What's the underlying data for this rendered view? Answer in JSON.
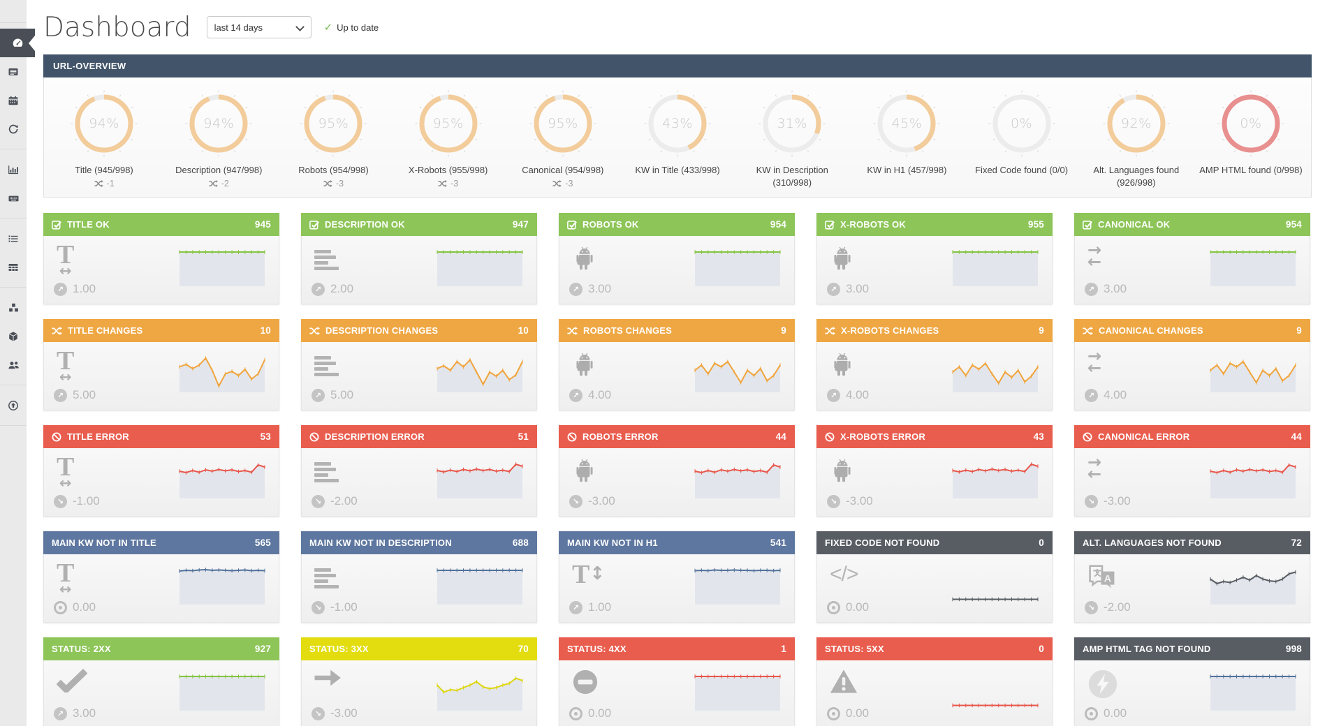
{
  "header": {
    "title": "Dashboard",
    "range_selected": "last 14 days",
    "status": "Up to date"
  },
  "sidebar": {
    "active": "dashboard",
    "groups": [
      [
        "dashboard",
        "news",
        "calendar",
        "sync"
      ],
      [
        "bar-chart",
        "keyboard"
      ],
      [
        "list",
        "table"
      ],
      [
        "cubes",
        "cube",
        "users"
      ],
      [
        "upload"
      ]
    ]
  },
  "overview": {
    "title": "URL-OVERVIEW",
    "gauges": [
      {
        "percent": 94,
        "label": "Title (945/998)",
        "delta": "-1",
        "ring": "orange"
      },
      {
        "percent": 94,
        "label": "Description (947/998)",
        "delta": "-2",
        "ring": "orange"
      },
      {
        "percent": 95,
        "label": "Robots (954/998)",
        "delta": "-3",
        "ring": "orange"
      },
      {
        "percent": 95,
        "label": "X-Robots (955/998)",
        "delta": "-3",
        "ring": "orange"
      },
      {
        "percent": 95,
        "label": "Canonical (954/998)",
        "delta": "-3",
        "ring": "orange"
      },
      {
        "percent": 43,
        "label": "KW in Title (433/998)",
        "delta": "",
        "ring": "orange"
      },
      {
        "percent": 31,
        "label": "KW in Description (310/998)",
        "delta": "",
        "ring": "orange"
      },
      {
        "percent": 45,
        "label": "KW in H1 (457/998)",
        "delta": "",
        "ring": "orange"
      },
      {
        "percent": 0,
        "label": "Fixed Code found (0/0)",
        "delta": "",
        "ring": "gray"
      },
      {
        "percent": 92,
        "label": "Alt. Languages found (926/998)",
        "delta": "",
        "ring": "orange"
      },
      {
        "percent": 0,
        "label": "AMP HTML found (0/998)",
        "delta": "",
        "ring": "red"
      }
    ]
  },
  "cards": [
    {
      "title": "TITLE OK",
      "value": "945",
      "variant": "green",
      "header_icon": "check-square",
      "body_icon": "text-width",
      "trend": "up",
      "trend_value": "1.00",
      "spark": {
        "color": "green",
        "fill": true,
        "points": [
          0.1,
          0.1,
          0.1,
          0.1,
          0.1,
          0.1,
          0.1,
          0.1,
          0.1,
          0.1,
          0.1,
          0.1,
          0.1,
          0.1
        ]
      }
    },
    {
      "title": "DESCRIPTION OK",
      "value": "947",
      "variant": "green",
      "header_icon": "check-square",
      "body_icon": "align-left",
      "trend": "up",
      "trend_value": "2.00",
      "spark": {
        "color": "green",
        "fill": true,
        "points": [
          0.1,
          0.1,
          0.1,
          0.1,
          0.1,
          0.1,
          0.1,
          0.1,
          0.1,
          0.1,
          0.1,
          0.1,
          0.1,
          0.1
        ]
      }
    },
    {
      "title": "ROBOTS OK",
      "value": "954",
      "variant": "green",
      "header_icon": "check-square",
      "body_icon": "android",
      "trend": "up",
      "trend_value": "3.00",
      "spark": {
        "color": "green",
        "fill": true,
        "points": [
          0.1,
          0.1,
          0.1,
          0.1,
          0.1,
          0.1,
          0.1,
          0.1,
          0.1,
          0.1,
          0.1,
          0.1,
          0.1,
          0.1
        ]
      }
    },
    {
      "title": "X-ROBOTS OK",
      "value": "955",
      "variant": "green",
      "header_icon": "check-square",
      "body_icon": "android",
      "trend": "up",
      "trend_value": "3.00",
      "spark": {
        "color": "green",
        "fill": true,
        "points": [
          0.1,
          0.1,
          0.1,
          0.1,
          0.1,
          0.1,
          0.1,
          0.1,
          0.1,
          0.1,
          0.1,
          0.1,
          0.1,
          0.1
        ]
      }
    },
    {
      "title": "CANONICAL OK",
      "value": "954",
      "variant": "green",
      "header_icon": "check-square",
      "body_icon": "exchange",
      "trend": "up",
      "trend_value": "3.00",
      "spark": {
        "color": "green",
        "fill": true,
        "points": [
          0.1,
          0.1,
          0.1,
          0.1,
          0.1,
          0.1,
          0.1,
          0.1,
          0.1,
          0.1,
          0.1,
          0.1,
          0.1,
          0.1
        ]
      }
    },
    {
      "title": "TITLE CHANGES",
      "value": "10",
      "variant": "orange",
      "header_icon": "shuffle",
      "body_icon": "text-width",
      "trend": "up",
      "trend_value": "5.00",
      "spark": {
        "color": "orange",
        "fill": true,
        "points": [
          0.35,
          0.28,
          0.4,
          0.3,
          0.1,
          0.45,
          0.9,
          0.55,
          0.48,
          0.6,
          0.42,
          0.7,
          0.55,
          0.15
        ]
      }
    },
    {
      "title": "DESCRIPTION CHANGES",
      "value": "10",
      "variant": "orange",
      "header_icon": "shuffle",
      "body_icon": "align-left",
      "trend": "up",
      "trend_value": "5.00",
      "spark": {
        "color": "orange",
        "fill": true,
        "points": [
          0.4,
          0.32,
          0.45,
          0.2,
          0.35,
          0.15,
          0.5,
          0.85,
          0.5,
          0.62,
          0.45,
          0.72,
          0.58,
          0.2
        ]
      }
    },
    {
      "title": "ROBOTS CHANGES",
      "value": "9",
      "variant": "orange",
      "header_icon": "shuffle",
      "body_icon": "android",
      "trend": "up",
      "trend_value": "4.00",
      "spark": {
        "color": "orange",
        "fill": true,
        "points": [
          0.45,
          0.3,
          0.55,
          0.25,
          0.35,
          0.2,
          0.5,
          0.8,
          0.45,
          0.6,
          0.4,
          0.75,
          0.6,
          0.3
        ]
      }
    },
    {
      "title": "X-ROBOTS CHANGES",
      "value": "9",
      "variant": "orange",
      "header_icon": "shuffle",
      "body_icon": "android",
      "trend": "up",
      "trend_value": "4.00",
      "spark": {
        "color": "orange",
        "fill": true,
        "points": [
          0.5,
          0.35,
          0.6,
          0.3,
          0.42,
          0.25,
          0.55,
          0.82,
          0.5,
          0.65,
          0.45,
          0.78,
          0.62,
          0.35
        ]
      }
    },
    {
      "title": "CANONICAL CHANGES",
      "value": "9",
      "variant": "orange",
      "header_icon": "shuffle",
      "body_icon": "exchange",
      "trend": "up",
      "trend_value": "4.00",
      "spark": {
        "color": "orange",
        "fill": true,
        "points": [
          0.45,
          0.3,
          0.55,
          0.25,
          0.35,
          0.2,
          0.5,
          0.8,
          0.45,
          0.6,
          0.4,
          0.75,
          0.6,
          0.3
        ]
      }
    },
    {
      "title": "TITLE ERROR",
      "value": "53",
      "variant": "red",
      "header_icon": "ban",
      "body_icon": "text-width",
      "trend": "down",
      "trend_value": "-1.00",
      "spark": {
        "color": "red",
        "fill": true,
        "points": [
          0.3,
          0.34,
          0.28,
          0.33,
          0.26,
          0.3,
          0.25,
          0.29,
          0.26,
          0.31,
          0.28,
          0.33,
          0.12,
          0.18
        ]
      }
    },
    {
      "title": "DESCRIPTION ERROR",
      "value": "51",
      "variant": "red",
      "header_icon": "ban",
      "body_icon": "align-left",
      "trend": "down",
      "trend_value": "-2.00",
      "spark": {
        "color": "red",
        "fill": true,
        "points": [
          0.28,
          0.32,
          0.27,
          0.31,
          0.25,
          0.29,
          0.24,
          0.28,
          0.25,
          0.3,
          0.27,
          0.31,
          0.1,
          0.16
        ]
      }
    },
    {
      "title": "ROBOTS ERROR",
      "value": "44",
      "variant": "red",
      "header_icon": "ban",
      "body_icon": "android",
      "trend": "down",
      "trend_value": "-3.00",
      "spark": {
        "color": "red",
        "fill": true,
        "points": [
          0.3,
          0.34,
          0.28,
          0.33,
          0.26,
          0.3,
          0.25,
          0.29,
          0.26,
          0.31,
          0.28,
          0.33,
          0.12,
          0.18
        ]
      }
    },
    {
      "title": "X-ROBOTS ERROR",
      "value": "43",
      "variant": "red",
      "header_icon": "ban",
      "body_icon": "android",
      "trend": "down",
      "trend_value": "-3.00",
      "spark": {
        "color": "red",
        "fill": true,
        "points": [
          0.28,
          0.32,
          0.27,
          0.31,
          0.25,
          0.29,
          0.24,
          0.28,
          0.25,
          0.3,
          0.27,
          0.31,
          0.1,
          0.16
        ]
      }
    },
    {
      "title": "CANONICAL ERROR",
      "value": "44",
      "variant": "red",
      "header_icon": "ban",
      "body_icon": "exchange",
      "trend": "down",
      "trend_value": "-3.00",
      "spark": {
        "color": "red",
        "fill": true,
        "points": [
          0.3,
          0.34,
          0.28,
          0.33,
          0.26,
          0.3,
          0.25,
          0.29,
          0.26,
          0.31,
          0.28,
          0.33,
          0.12,
          0.18
        ]
      }
    },
    {
      "title": "MAIN KW NOT IN TITLE",
      "value": "565",
      "variant": "blue",
      "header_icon": "",
      "body_icon": "text-width",
      "trend": "zero",
      "trend_value": "0.00",
      "spark": {
        "color": "blue",
        "fill": true,
        "points": [
          0.12,
          0.1,
          0.11,
          0.09,
          0.08,
          0.1,
          0.09,
          0.1,
          0.11,
          0.1,
          0.09,
          0.11,
          0.1,
          0.11
        ]
      }
    },
    {
      "title": "MAIN KW NOT IN DESCRIPTION",
      "value": "688",
      "variant": "blue",
      "header_icon": "",
      "body_icon": "align-left",
      "trend": "down",
      "trend_value": "-1.00",
      "spark": {
        "color": "blue",
        "fill": true,
        "points": [
          0.1,
          0.1,
          0.1,
          0.1,
          0.1,
          0.1,
          0.1,
          0.1,
          0.1,
          0.1,
          0.1,
          0.1,
          0.1,
          0.1
        ]
      }
    },
    {
      "title": "MAIN KW NOT IN H1",
      "value": "541",
      "variant": "blue",
      "header_icon": "",
      "body_icon": "text-height",
      "trend": "up",
      "trend_value": "1.00",
      "spark": {
        "color": "blue",
        "fill": true,
        "points": [
          0.11,
          0.1,
          0.11,
          0.09,
          0.1,
          0.1,
          0.09,
          0.1,
          0.1,
          0.11,
          0.1,
          0.1,
          0.11,
          0.1
        ]
      }
    },
    {
      "title": "FIXED CODE NOT FOUND",
      "value": "0",
      "variant": "dark",
      "header_icon": "",
      "body_icon": "code",
      "trend": "zero",
      "trend_value": "0.00",
      "spark": {
        "color": "dark",
        "fill": false,
        "points": [
          0.93,
          0.93,
          0.93,
          0.93,
          0.93,
          0.93,
          0.93,
          0.93,
          0.93,
          0.93,
          0.93,
          0.93,
          0.93,
          0.93
        ]
      }
    },
    {
      "title": "ALT. LANGUAGES NOT FOUND",
      "value": "72",
      "variant": "dark",
      "header_icon": "",
      "body_icon": "language",
      "trend": "down",
      "trend_value": "-2.00",
      "spark": {
        "color": "dark",
        "fill": true,
        "points": [
          0.35,
          0.48,
          0.42,
          0.45,
          0.38,
          0.3,
          0.38,
          0.25,
          0.35,
          0.4,
          0.42,
          0.35,
          0.2,
          0.15
        ]
      }
    },
    {
      "title": "STATUS: 2XX",
      "value": "927",
      "variant": "green",
      "header_icon": "",
      "body_icon": "check",
      "trend": "up",
      "trend_value": "3.00",
      "spark": {
        "color": "green",
        "fill": true,
        "points": [
          0.1,
          0.1,
          0.1,
          0.1,
          0.1,
          0.1,
          0.1,
          0.1,
          0.1,
          0.1,
          0.1,
          0.1,
          0.1,
          0.1
        ]
      }
    },
    {
      "title": "STATUS: 3XX",
      "value": "70",
      "variant": "yellow",
      "header_icon": "",
      "body_icon": "arrow-right",
      "trend": "down",
      "trend_value": "-3.00",
      "spark": {
        "color": "yellow",
        "fill": true,
        "points": [
          0.35,
          0.55,
          0.48,
          0.5,
          0.42,
          0.35,
          0.25,
          0.4,
          0.45,
          0.42,
          0.35,
          0.3,
          0.15,
          0.22
        ]
      }
    },
    {
      "title": "STATUS: 4XX",
      "value": "1",
      "variant": "red",
      "header_icon": "",
      "body_icon": "minus-circle",
      "trend": "zero",
      "trend_value": "0.00",
      "spark": {
        "color": "red",
        "fill": true,
        "points": [
          0.1,
          0.1,
          0.1,
          0.1,
          0.1,
          0.1,
          0.1,
          0.1,
          0.1,
          0.1,
          0.1,
          0.1,
          0.1,
          0.1
        ]
      }
    },
    {
      "title": "STATUS: 5XX",
      "value": "0",
      "variant": "red",
      "header_icon": "",
      "body_icon": "warning",
      "trend": "zero",
      "trend_value": "0.00",
      "spark": {
        "color": "red",
        "fill": false,
        "points": [
          0.93,
          0.93,
          0.93,
          0.93,
          0.93,
          0.93,
          0.93,
          0.93,
          0.93,
          0.93,
          0.93,
          0.93,
          0.93,
          0.93
        ]
      }
    },
    {
      "title": "AMP HTML TAG NOT FOUND",
      "value": "998",
      "variant": "dark",
      "header_icon": "",
      "body_icon": "bolt",
      "trend": "zero",
      "trend_value": "0.00",
      "spark": {
        "color": "blue",
        "fill": true,
        "points": [
          0.1,
          0.1,
          0.1,
          0.1,
          0.1,
          0.1,
          0.1,
          0.1,
          0.1,
          0.1,
          0.1,
          0.1,
          0.1,
          0.1
        ]
      }
    }
  ],
  "colors": {
    "green": "#8dc558",
    "orange": "#efa743",
    "red": "#e95d4e",
    "blue": "#5e77a0",
    "dark": "#585d64",
    "yellow": "#e3dd10",
    "panel_header": "#415469",
    "status_check": "#76b84e",
    "sidebar_bg": "#eaeaea",
    "sidebar_icon": "#4a4f57",
    "sidebar_active_bg": "#4a4f57",
    "spark_lines": {
      "green": "#85c442",
      "orange": "#f1a43b",
      "red": "#e8564a",
      "blue": "#53719b",
      "dark": "#565b62",
      "yellow": "#ddd60e"
    },
    "spark_fill": "#e2e6ec",
    "gauge": {
      "fill": "#f3cc9b",
      "empty": "#ececec",
      "red_empty": "#e8908f",
      "text": "#c9c9c9"
    }
  }
}
